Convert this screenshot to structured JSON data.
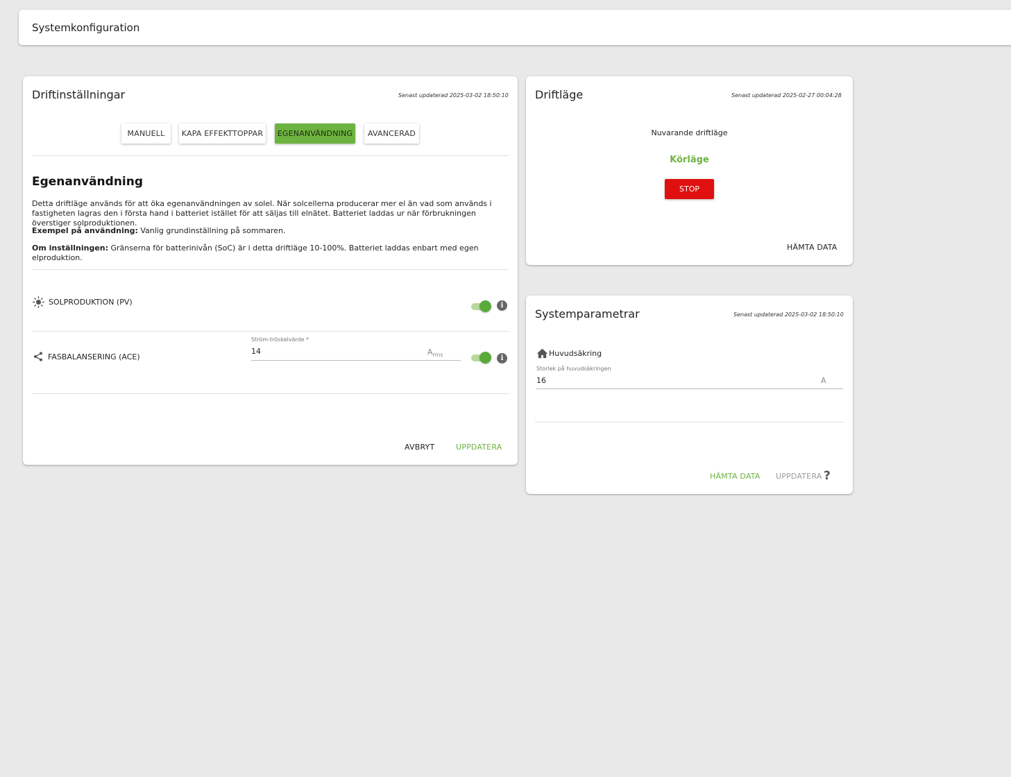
{
  "header": {
    "title": "Systemkonfiguration"
  },
  "drift_settings": {
    "title": "Driftinställningar",
    "updated": "Senast updaterad 2025-03-02 18:50:10",
    "modes": [
      "MANUELL",
      "KAPA EFFEKTTOPPAR",
      "EGENANVÄNDNING",
      "AVANCERAD"
    ],
    "active_mode": "EGENANVÄNDNING",
    "section_title": "Egenanvändning",
    "description": "Detta driftläge används för att öka egenanvändningen av solel. När solcellerna producerar mer el än vad som används i fastigheten lagras den i första hand i batteriet istället för att säljas till elnätet. Batteriet laddas ur när förbrukningen överstiger solproduktionen.",
    "example_label": "Exempel på användning:",
    "example_text": "Vanlig grundinställning på sommaren.",
    "about_label": "Om inställningen:",
    "about_text": "Gränserna för batterinivån (SoC) är i detta driftläge 10-100%. Batteriet laddas enbart med egen elproduktion.",
    "pv": {
      "label": "SOLPRODUKTION (PV)",
      "icon": "sun-icon",
      "enabled": true
    },
    "ace": {
      "label": "FASBALANSERING (ACE)",
      "icon": "share-icon",
      "enabled": true,
      "field_label": "Ström-tröskelvärde *",
      "value": "14",
      "unit_main": "A",
      "unit_sub": "rms"
    },
    "cancel": "AVBRYT",
    "update": "UPPDATERA"
  },
  "drift_mode": {
    "title": "Driftläge",
    "updated": "Senast updaterad 2025-02-27 00:04:28",
    "current_label": "Nuvarande driftläge",
    "current_value": "Körläge",
    "stop": "STOP",
    "fetch": "HÄMTA DATA"
  },
  "system_params": {
    "title": "Systemparametrar",
    "updated": "Senast updaterad 2025-03-02 18:50:10",
    "fuse_label": "Huvudsäkring",
    "fuse_icon": "home-icon",
    "field_label": "Storlek på huvudsäkringen",
    "value": "16",
    "unit": "A",
    "fetch": "HÄMTA DATA",
    "update": "UPPDATERA",
    "help": "?"
  },
  "colors": {
    "accent_green": "#6db33f",
    "stop_red": "#e01010",
    "disabled_grey": "#9a9a9a"
  }
}
